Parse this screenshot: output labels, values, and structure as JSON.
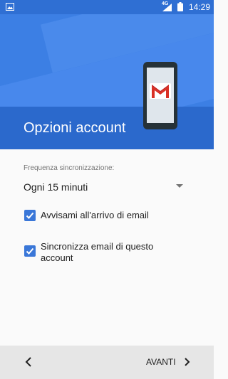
{
  "status_bar": {
    "network": "4G",
    "time": "14:29",
    "icons": [
      "gallery-icon",
      "signal-icon",
      "battery-icon"
    ]
  },
  "header": {
    "title": "Opzioni account",
    "illustration": "phone-gmail-icon"
  },
  "sync": {
    "label": "Frequenza sincronizzazione:",
    "value": "Ogni 15 minuti"
  },
  "options": [
    {
      "label": "Avvisami all'arrivo di email",
      "checked": true
    },
    {
      "label": "Sincronizza email di questo account",
      "checked": true
    }
  ],
  "footer": {
    "next_label": "AVANTI"
  },
  "colors": {
    "primary": "#3c7fe4",
    "band": "#2b69cc",
    "checkbox": "#3a77d8"
  }
}
